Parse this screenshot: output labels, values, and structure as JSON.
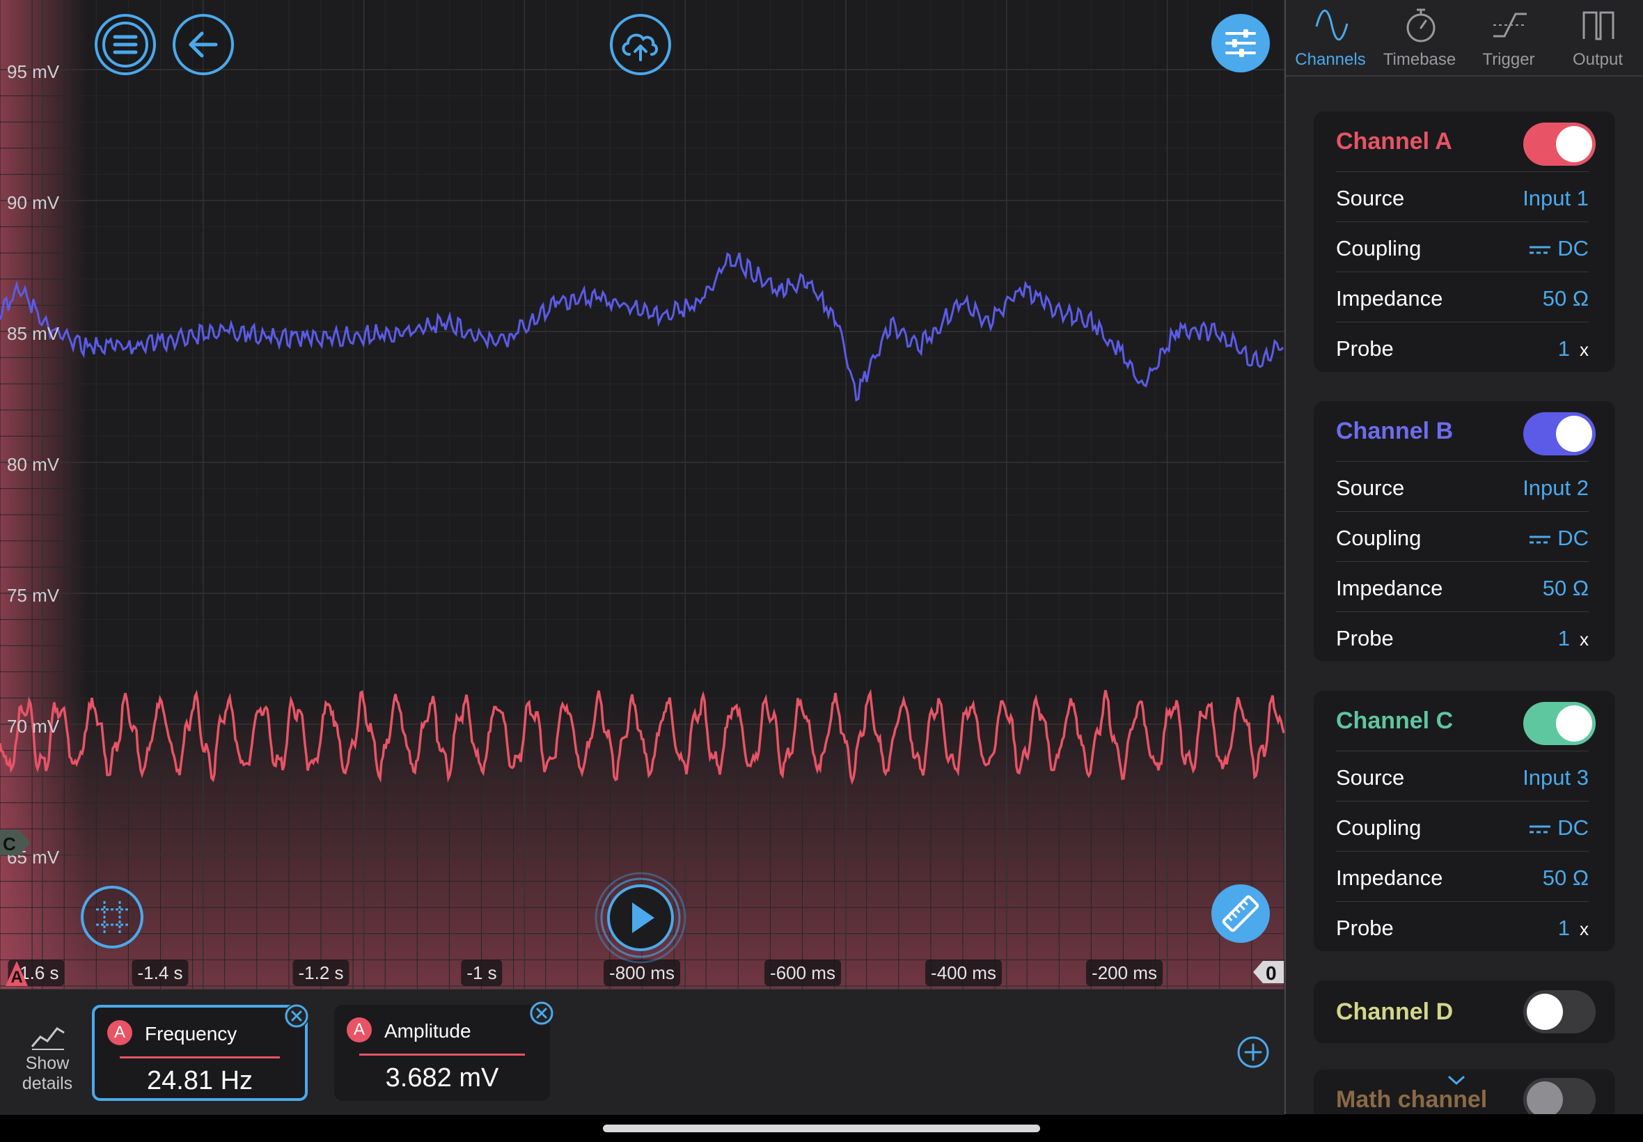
{
  "scope": {
    "y_axis_labels": [
      "95 mV",
      "90 mV",
      "85 mV",
      "80 mV",
      "75 mV",
      "70 mV",
      "65 mV"
    ],
    "x_axis_labels": [
      "-1.6 s",
      "-1.4 s",
      "-1.2 s",
      "-1 s",
      "-800 ms",
      "-600 ms",
      "-400 ms",
      "-200 ms"
    ],
    "channel_a_marker": "A",
    "channel_c_marker": "C",
    "trigger_zero_marker": "0",
    "colors": {
      "channel_a": "#e85466",
      "channel_b": "#5b5be8",
      "channel_c": "#5ec7a0",
      "accent": "#4ba9ec"
    }
  },
  "toolbar": {
    "menu_icon": "hamburger-menu-icon",
    "back_icon": "back-arrow-icon",
    "upload_icon": "cloud-upload-icon",
    "settings_icon": "sliders-icon",
    "grid_icon": "grid-cursor-icon",
    "play_icon": "play-icon",
    "measure_icon": "ruler-icon"
  },
  "measurements": {
    "show_details_line1": "Show",
    "show_details_line2": "details",
    "items": [
      {
        "badge": "A",
        "title": "Frequency",
        "value": "24.81 Hz"
      },
      {
        "badge": "A",
        "title": "Amplitude",
        "value": "3.682 mV"
      }
    ]
  },
  "tabs": [
    {
      "label": "Channels",
      "icon": "sine-wave-icon",
      "active": true
    },
    {
      "label": "Timebase",
      "icon": "stopwatch-icon",
      "active": false
    },
    {
      "label": "Trigger",
      "icon": "trigger-edge-icon",
      "active": false
    },
    {
      "label": "Output",
      "icon": "square-wave-icon",
      "active": false
    }
  ],
  "channels": [
    {
      "name": "Channel A",
      "enabled": true,
      "source": "Input 1",
      "coupling": "DC",
      "impedance": "50 Ω",
      "probe": "1",
      "probe_unit": "x"
    },
    {
      "name": "Channel B",
      "enabled": true,
      "source": "Input 2",
      "coupling": "DC",
      "impedance": "50 Ω",
      "probe": "1",
      "probe_unit": "x"
    },
    {
      "name": "Channel C",
      "enabled": true,
      "source": "Input 3",
      "coupling": "DC",
      "impedance": "50 Ω",
      "probe": "1",
      "probe_unit": "x"
    },
    {
      "name": "Channel D",
      "enabled": false
    },
    {
      "name": "Math channel",
      "enabled": false
    }
  ],
  "row_labels": {
    "source": "Source",
    "coupling": "Coupling",
    "impedance": "Impedance",
    "probe": "Probe"
  }
}
